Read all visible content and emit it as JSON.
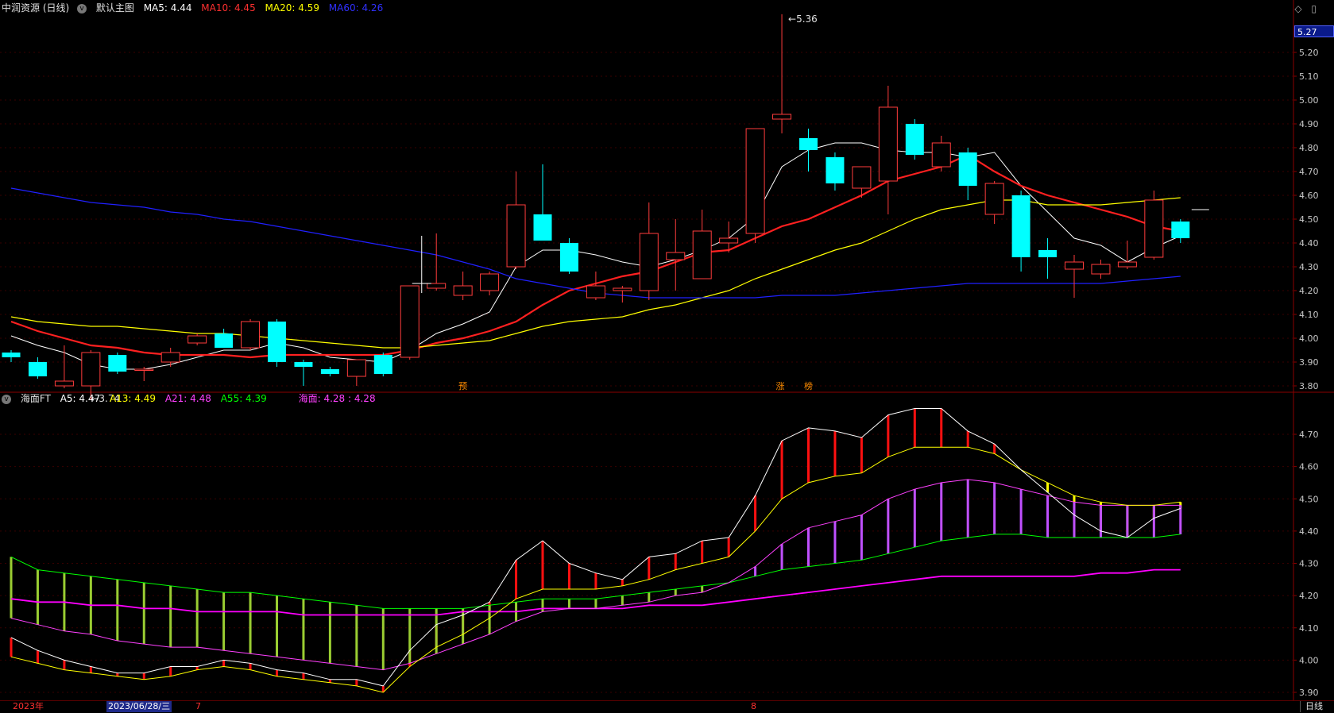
{
  "top_panel": {
    "title": "中润资源 (日线)",
    "indicator_name": "默认主图",
    "ma5": "MA5: 4.44",
    "ma10": "MA10: 4.45",
    "ma20": "MA20: 4.59",
    "ma60": "MA60: 4.26",
    "price_tag": "5.27",
    "high_label": "5.36",
    "low_label": "3.74",
    "markers": [
      "预",
      "涨",
      "榜"
    ]
  },
  "bottom_panel": {
    "title": "海面FT",
    "a5": "A5: 4.47",
    "a13": "A13: 4.49",
    "a21": "A21: 4.48",
    "a55": "A55: 4.39",
    "haimian": "海面: 4.28 : 4.28"
  },
  "footer": {
    "year": "2023年",
    "date": "2023/06/28/三",
    "m7": "7",
    "m8": "8",
    "period": "日线"
  },
  "colors": {
    "up": "#ff3c3c",
    "down": "#00ffff",
    "ma5": "#ffffff",
    "ma10": "#ff2020",
    "ma20": "#ffff00",
    "ma60": "#2020ff",
    "green": "#00ff00",
    "magenta": "#ff40ff"
  },
  "chart_data": [
    {
      "type": "candlestick",
      "title": "中润资源 (日线)",
      "ylim": [
        3.72,
        5.4
      ],
      "yticks": [
        3.8,
        3.9,
        4.0,
        4.1,
        4.2,
        4.3,
        4.4,
        4.5,
        4.6,
        4.7,
        4.8,
        4.9,
        5.0,
        5.1,
        5.2
      ],
      "ohlc": [
        [
          3.94,
          3.95,
          3.9,
          3.92
        ],
        [
          3.9,
          3.92,
          3.83,
          3.84
        ],
        [
          3.8,
          3.97,
          3.79,
          3.82
        ],
        [
          3.8,
          3.95,
          3.74,
          3.94
        ],
        [
          3.93,
          3.94,
          3.85,
          3.86
        ],
        [
          3.87,
          3.88,
          3.82,
          3.87
        ],
        [
          3.9,
          3.96,
          3.88,
          3.94
        ],
        [
          3.98,
          4.02,
          3.97,
          4.01
        ],
        [
          4.02,
          4.04,
          3.96,
          3.96
        ],
        [
          3.96,
          4.08,
          3.95,
          4.07
        ],
        [
          4.07,
          4.08,
          3.88,
          3.9
        ],
        [
          3.9,
          3.91,
          3.8,
          3.88
        ],
        [
          3.87,
          3.88,
          3.84,
          3.85
        ],
        [
          3.84,
          3.91,
          3.8,
          3.91
        ],
        [
          3.93,
          3.94,
          3.84,
          3.85
        ],
        [
          3.92,
          4.22,
          3.91,
          4.22
        ],
        [
          4.21,
          4.44,
          4.2,
          4.23
        ],
        [
          4.18,
          4.28,
          4.16,
          4.22
        ],
        [
          4.2,
          4.28,
          4.18,
          4.27
        ],
        [
          4.3,
          4.7,
          4.29,
          4.56
        ],
        [
          4.52,
          4.73,
          4.44,
          4.41
        ],
        [
          4.4,
          4.42,
          4.27,
          4.28
        ],
        [
          4.17,
          4.28,
          4.16,
          4.22
        ],
        [
          4.2,
          4.22,
          4.15,
          4.21
        ],
        [
          4.2,
          4.57,
          4.16,
          4.44
        ],
        [
          4.33,
          4.5,
          4.2,
          4.36
        ],
        [
          4.25,
          4.54,
          4.25,
          4.45
        ],
        [
          4.4,
          4.49,
          4.36,
          4.42
        ],
        [
          4.44,
          4.88,
          4.4,
          4.88
        ],
        [
          4.92,
          5.36,
          4.86,
          4.94
        ],
        [
          4.84,
          4.88,
          4.7,
          4.79
        ],
        [
          4.76,
          4.78,
          4.62,
          4.65
        ],
        [
          4.63,
          4.72,
          4.59,
          4.72
        ],
        [
          4.66,
          5.06,
          4.52,
          4.97
        ],
        [
          4.9,
          4.92,
          4.75,
          4.77
        ],
        [
          4.72,
          4.85,
          4.7,
          4.82
        ],
        [
          4.78,
          4.8,
          4.58,
          4.64
        ],
        [
          4.52,
          4.66,
          4.48,
          4.65
        ],
        [
          4.6,
          4.62,
          4.28,
          4.34
        ],
        [
          4.37,
          4.42,
          4.25,
          4.34
        ],
        [
          4.29,
          4.35,
          4.17,
          4.32
        ],
        [
          4.27,
          4.33,
          4.25,
          4.31
        ],
        [
          4.3,
          4.41,
          4.29,
          4.32
        ],
        [
          4.34,
          4.62,
          4.33,
          4.58
        ],
        [
          4.49,
          4.5,
          4.4,
          4.42
        ]
      ],
      "last_tick": 4.54,
      "series": [
        {
          "name": "MA5",
          "values": [
            4.01,
            3.97,
            3.94,
            3.89,
            3.87,
            3.87,
            3.89,
            3.92,
            3.95,
            3.95,
            3.98,
            3.96,
            3.92,
            3.91,
            3.9,
            3.95,
            4.02,
            4.06,
            4.11,
            4.3,
            4.37,
            4.37,
            4.35,
            4.32,
            4.3,
            4.33,
            4.37,
            4.42,
            4.51,
            4.72,
            4.79,
            4.82,
            4.82,
            4.79,
            4.78,
            4.78,
            4.76,
            4.78,
            4.64,
            4.53,
            4.42,
            4.39,
            4.32,
            4.38,
            4.43
          ]
        },
        {
          "name": "MA10",
          "values": [
            4.07,
            4.03,
            4.0,
            3.97,
            3.96,
            3.94,
            3.93,
            3.93,
            3.93,
            3.92,
            3.93,
            3.93,
            3.93,
            3.93,
            3.93,
            3.95,
            3.98,
            4.0,
            4.03,
            4.07,
            4.14,
            4.2,
            4.23,
            4.26,
            4.28,
            4.32,
            4.36,
            4.37,
            4.42,
            4.47,
            4.5,
            4.55,
            4.6,
            4.66,
            4.69,
            4.72,
            4.77,
            4.7,
            4.64,
            4.6,
            4.57,
            4.54,
            4.51,
            4.47,
            4.45
          ]
        },
        {
          "name": "MA20",
          "values": [
            4.09,
            4.07,
            4.06,
            4.05,
            4.05,
            4.04,
            4.03,
            4.02,
            4.02,
            4.01,
            4.0,
            3.99,
            3.98,
            3.97,
            3.96,
            3.96,
            3.97,
            3.98,
            3.99,
            4.02,
            4.05,
            4.07,
            4.08,
            4.09,
            4.12,
            4.14,
            4.17,
            4.2,
            4.25,
            4.29,
            4.33,
            4.37,
            4.4,
            4.45,
            4.5,
            4.54,
            4.56,
            4.58,
            4.58,
            4.56,
            4.56,
            4.56,
            4.57,
            4.58,
            4.59
          ]
        },
        {
          "name": "MA60",
          "values": [
            4.63,
            4.61,
            4.59,
            4.57,
            4.56,
            4.55,
            4.53,
            4.52,
            4.5,
            4.49,
            4.47,
            4.45,
            4.43,
            4.41,
            4.39,
            4.37,
            4.35,
            4.32,
            4.29,
            4.25,
            4.23,
            4.21,
            4.19,
            4.18,
            4.17,
            4.17,
            4.17,
            4.17,
            4.17,
            4.18,
            4.18,
            4.18,
            4.19,
            4.2,
            4.21,
            4.22,
            4.23,
            4.23,
            4.23,
            4.23,
            4.23,
            4.23,
            4.24,
            4.25,
            4.26
          ]
        }
      ]
    },
    {
      "type": "line",
      "title": "海面FT",
      "ylim": [
        3.88,
        4.8
      ],
      "yticks": [
        3.9,
        4.0,
        4.1,
        4.2,
        4.3,
        4.4,
        4.5,
        4.6,
        4.7
      ],
      "series": [
        {
          "name": "A5",
          "values": [
            4.07,
            4.03,
            4.0,
            3.98,
            3.96,
            3.96,
            3.98,
            3.98,
            4.0,
            3.99,
            3.97,
            3.96,
            3.94,
            3.94,
            3.92,
            4.03,
            4.11,
            4.14,
            4.18,
            4.31,
            4.37,
            4.3,
            4.27,
            4.25,
            4.32,
            4.33,
            4.37,
            4.38,
            4.51,
            4.68,
            4.72,
            4.71,
            4.69,
            4.76,
            4.78,
            4.78,
            4.71,
            4.67,
            4.59,
            4.52,
            4.45,
            4.4,
            4.38,
            4.44,
            4.47
          ]
        },
        {
          "name": "A13",
          "values": [
            4.01,
            3.99,
            3.97,
            3.96,
            3.95,
            3.94,
            3.95,
            3.97,
            3.98,
            3.97,
            3.95,
            3.94,
            3.93,
            3.92,
            3.9,
            3.98,
            4.04,
            4.08,
            4.13,
            4.19,
            4.22,
            4.22,
            4.22,
            4.23,
            4.25,
            4.28,
            4.3,
            4.32,
            4.4,
            4.5,
            4.55,
            4.57,
            4.58,
            4.63,
            4.66,
            4.66,
            4.66,
            4.64,
            4.59,
            4.55,
            4.51,
            4.49,
            4.48,
            4.48,
            4.49
          ]
        },
        {
          "name": "A21",
          "values": [
            4.13,
            4.11,
            4.09,
            4.08,
            4.06,
            4.05,
            4.04,
            4.04,
            4.03,
            4.02,
            4.01,
            4.0,
            3.99,
            3.98,
            3.97,
            3.99,
            4.02,
            4.05,
            4.08,
            4.12,
            4.15,
            4.16,
            4.16,
            4.17,
            4.18,
            4.2,
            4.21,
            4.24,
            4.29,
            4.36,
            4.41,
            4.43,
            4.45,
            4.5,
            4.53,
            4.55,
            4.56,
            4.55,
            4.53,
            4.51,
            4.49,
            4.48,
            4.48,
            4.48,
            4.48
          ]
        },
        {
          "name": "A55",
          "values": [
            4.32,
            4.28,
            4.27,
            4.26,
            4.25,
            4.24,
            4.23,
            4.22,
            4.21,
            4.21,
            4.2,
            4.19,
            4.18,
            4.17,
            4.16,
            4.16,
            4.16,
            4.16,
            4.17,
            4.18,
            4.19,
            4.19,
            4.19,
            4.2,
            4.21,
            4.22,
            4.23,
            4.24,
            4.26,
            4.28,
            4.29,
            4.3,
            4.31,
            4.33,
            4.35,
            4.37,
            4.38,
            4.39,
            4.39,
            4.38,
            4.38,
            4.38,
            4.38,
            4.38,
            4.39
          ]
        },
        {
          "name": "A60",
          "values": [
            4.19,
            4.18,
            4.18,
            4.17,
            4.17,
            4.16,
            4.16,
            4.15,
            4.15,
            4.15,
            4.15,
            4.14,
            4.14,
            4.14,
            4.14,
            4.14,
            4.14,
            4.15,
            4.15,
            4.15,
            4.16,
            4.16,
            4.16,
            4.16,
            4.17,
            4.17,
            4.17,
            4.18,
            4.19,
            4.2,
            4.21,
            4.22,
            4.23,
            4.24,
            4.25,
            4.26,
            4.26,
            4.26,
            4.26,
            4.26,
            4.26,
            4.27,
            4.27,
            4.28,
            4.28
          ]
        }
      ]
    }
  ]
}
